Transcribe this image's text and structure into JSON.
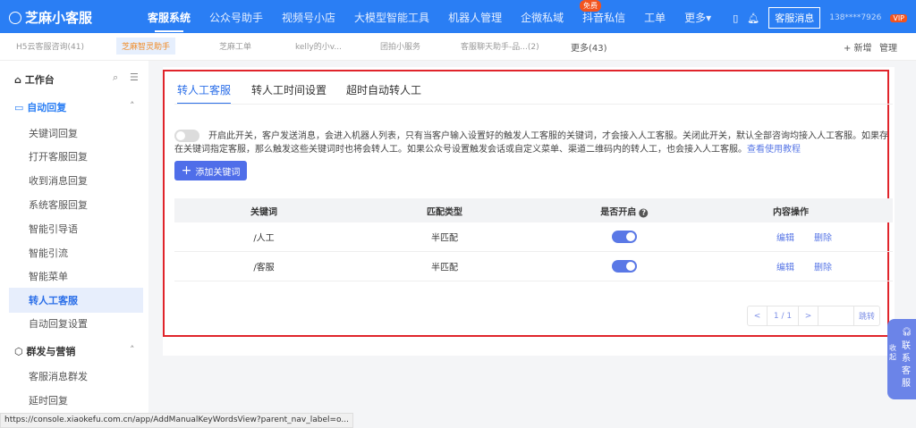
{
  "topbar": {
    "logo": "芝麻小客服",
    "nav": [
      "客服系统",
      "公众号助手",
      "视频号小店",
      "大模型智能工具",
      "机器人管理",
      "企微私域",
      "抖音私信",
      "工单",
      "更多▾"
    ],
    "badge": "免费",
    "kf_button": "客服消息",
    "user": "138****7926",
    "vip": "VIP"
  },
  "tabbar": {
    "tabs": [
      "H5云客服咨询(41)",
      "芝麻智灵助手",
      "芝麻工单",
      "kelly的小v...",
      "团拍小服务",
      "客服聊天助手-品...(2)"
    ],
    "more": "更多(43)",
    "add": "+ 新增",
    "manage": "管理"
  },
  "sidebar": {
    "workbench": "工作台",
    "group1": "自动回复",
    "items1": [
      "关键词回复",
      "打开客服回复",
      "收到消息回复",
      "系统客服回复",
      "智能引导语",
      "智能引流",
      "智能菜单",
      "转人工客服",
      "自动回复设置"
    ],
    "group2": "群发与营销",
    "items2": [
      "客服消息群发",
      "延时回复"
    ]
  },
  "main": {
    "tabs": [
      "转人工客服",
      "转人工时间设置",
      "超时自动转人工"
    ],
    "description": "开启此开关，客户发送消息，会进入机器人列表，只有当客户输入设置好的触发人工客服的关键词，才会接入人工客服。关闭此开关，默认全部咨询均接入人工客服。如果存在关键词指定客服，那么触发这些关键词时也将会转人工。如果公众号设置触发会话或自定义菜单、渠道二维码内的转人工，也会接入人工客服。",
    "tutorial_link": "查看使用教程",
    "master_toggle_on": false,
    "add_button": "添加关键词",
    "table": {
      "headers": [
        "关键词",
        "匹配类型",
        "是否开启",
        "内容操作"
      ],
      "rows": [
        {
          "keyword": "/人工",
          "match": "半匹配",
          "enabled": true,
          "edit": "编辑",
          "delete": "删除"
        },
        {
          "keyword": "/客服",
          "match": "半匹配",
          "enabled": true,
          "edit": "编辑",
          "delete": "删除"
        }
      ]
    },
    "pager": {
      "prev": "<",
      "page": "1 / 1",
      "next": ">",
      "jump": "跳转"
    }
  },
  "float": {
    "collapse": "收起",
    "contact": "联系客服"
  },
  "status_url": "https://console.xiaokefu.com.cn/app/AddManualKeyWordsView?parent_nav_label=o...",
  "colors": {
    "brand": "#2a7ef4",
    "accent": "#4f6ee9",
    "highlight": "#e0242b"
  }
}
